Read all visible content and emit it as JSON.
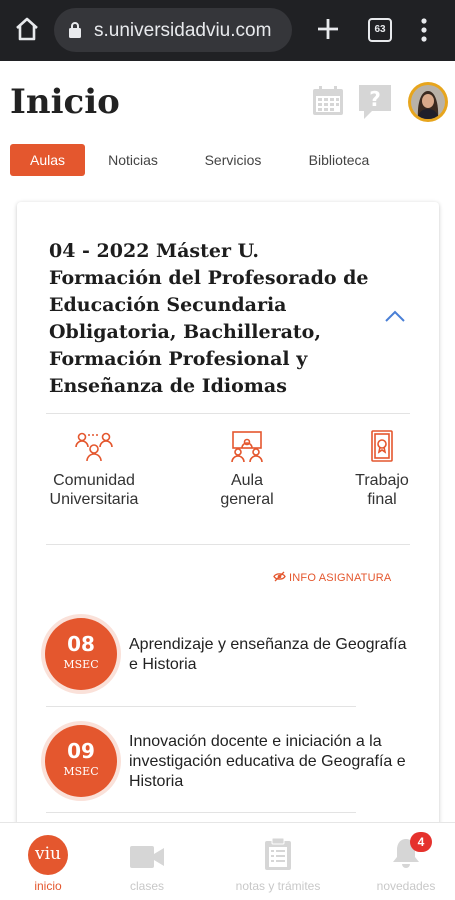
{
  "browser": {
    "url": "s.universidadviu.com",
    "tab_count": "63"
  },
  "header": {
    "title": "Inicio"
  },
  "tabs": [
    {
      "label": "Aulas",
      "active": true
    },
    {
      "label": "Noticias",
      "active": false
    },
    {
      "label": "Servicios",
      "active": false
    },
    {
      "label": "Biblioteca",
      "active": false
    }
  ],
  "course": {
    "title": "04 - 2022 Máster U. Formación del Profesorado de Educación Secundaria Obligatoria, Bachillerato, Formación Profesional y Enseñanza de Idiomas",
    "quick_access": [
      {
        "line1": "Comunidad",
        "line2": "Universitaria",
        "icon": "community-icon"
      },
      {
        "line1": "Aula",
        "line2": "general",
        "icon": "classroom-icon"
      },
      {
        "line1": "Trabajo",
        "line2": "final",
        "icon": "final-work-icon"
      }
    ],
    "info_link": "INFO ASIGNATURA",
    "subjects": [
      {
        "number": "08",
        "code": "MSEC",
        "name": "Aprendizaje y enseñanza de Geografía e Historia"
      },
      {
        "number": "09",
        "code": "MSEC",
        "name": "Innovación docente e iniciación a la investigación educativa de Geografía e Historia"
      }
    ]
  },
  "bottom_nav": [
    {
      "label": "inicio",
      "icon": "viu-logo-icon",
      "active": true
    },
    {
      "label": "clases",
      "icon": "video-camera-icon",
      "active": false
    },
    {
      "label": "notas y trámites",
      "icon": "clipboard-icon",
      "active": false
    },
    {
      "label": "novedades",
      "icon": "bell-icon",
      "active": false,
      "badge": "4"
    }
  ],
  "colors": {
    "accent": "#e4572e",
    "chrome": "#202124",
    "badge": "#e5322d"
  }
}
